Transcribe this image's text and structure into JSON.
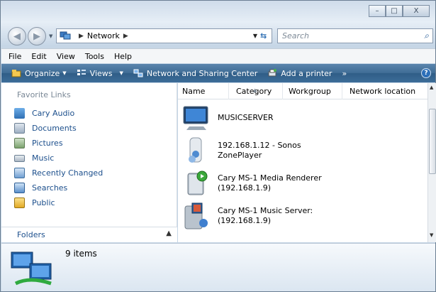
{
  "window": {
    "caption": {
      "minimize": "–",
      "maximize": "□",
      "close": "X"
    }
  },
  "address": {
    "location": "Network",
    "search_placeholder": "Search"
  },
  "menu": [
    "File",
    "Edit",
    "View",
    "Tools",
    "Help"
  ],
  "toolbar": {
    "organize": "Organize",
    "views": "Views",
    "network_sharing": "Network and Sharing Center",
    "add_printer": "Add a printer",
    "more": "»",
    "help": "?"
  },
  "favorites": {
    "title": "Favorite Links",
    "items": [
      {
        "label": "Cary Audio",
        "icon": "cary-audio-icon"
      },
      {
        "label": "Documents",
        "icon": "documents-icon"
      },
      {
        "label": "Pictures",
        "icon": "pictures-icon"
      },
      {
        "label": "Music",
        "icon": "music-icon"
      },
      {
        "label": "Recently Changed",
        "icon": "recently-changed-icon"
      },
      {
        "label": "Searches",
        "icon": "searches-icon"
      },
      {
        "label": "Public",
        "icon": "public-icon"
      }
    ],
    "folders_label": "Folders"
  },
  "columns": [
    "Name",
    "Category",
    "Workgroup",
    "Network location"
  ],
  "items": [
    {
      "line1": "MUSICSERVER",
      "line2": "",
      "icon": "computer-icon"
    },
    {
      "line1": "192.168.1.12 - Sonos",
      "line2": "ZonePlayer",
      "icon": "media-device-icon"
    },
    {
      "line1": "Cary MS-1 Media Renderer",
      "line2": "(192.168.1.9)",
      "icon": "media-renderer-icon"
    },
    {
      "line1": "Cary MS-1 Music Server:",
      "line2": "(192.168.1.9)",
      "icon": "media-server-icon"
    }
  ],
  "details": {
    "count": "9 items"
  },
  "colors": {
    "toolbar": "#3f6c95",
    "link": "#1c4f8c"
  }
}
